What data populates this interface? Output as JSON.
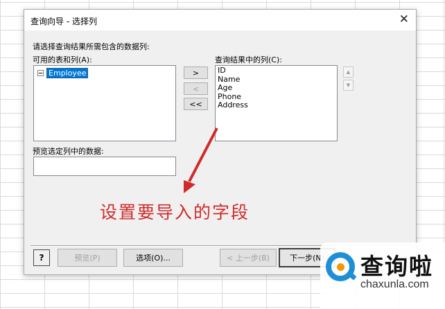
{
  "dialog": {
    "title": "查询向导 - 选择列",
    "close_glyph": "✕"
  },
  "prompt": "请选择查询结果所需包含的数据列:",
  "available": {
    "label": "可用的表和列(A):",
    "tree": [
      {
        "label": "Employee",
        "expanded": true,
        "selected": true
      }
    ]
  },
  "move": {
    "add": ">",
    "remove": "<",
    "remove_all": "<<"
  },
  "result": {
    "label": "查询结果中的列(C):",
    "columns": [
      "ID",
      "Name",
      "Age",
      "Phone",
      "Address"
    ]
  },
  "preview": {
    "label": "预览选定列中的数据:",
    "value": ""
  },
  "footer": {
    "help_icon": "?",
    "preview_btn": "预览(P)",
    "options_btn": "选项(O)...",
    "back_btn": "< 上一步(B)",
    "next_btn": "下一步(N)"
  },
  "annotation": "设置要导入的字段",
  "watermark": {
    "cn": "查询啦",
    "en": "chaxunla.com"
  },
  "colors": {
    "annotation": "#d02b2b",
    "selection": "#0078d7",
    "watermark_blue": "#1e8fd6",
    "watermark_orange": "#f39800"
  }
}
